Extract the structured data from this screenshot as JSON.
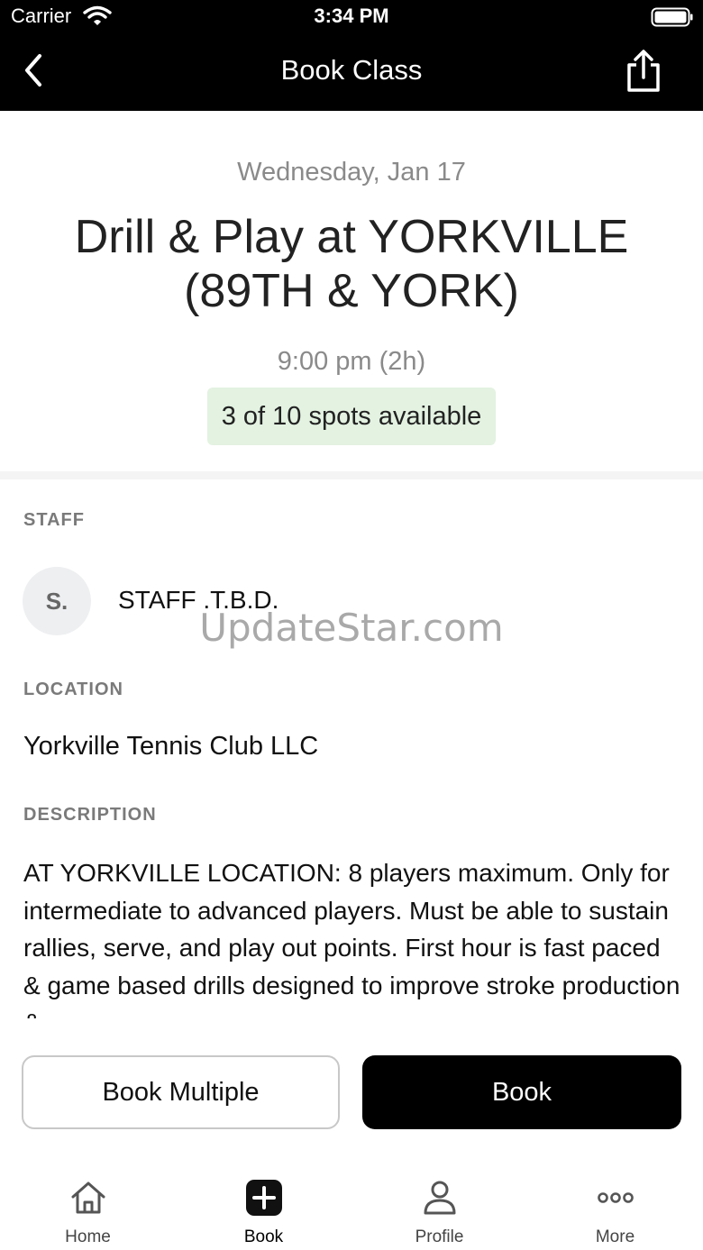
{
  "status_bar": {
    "carrier": "Carrier",
    "time": "3:34 PM"
  },
  "nav": {
    "title": "Book Class"
  },
  "class": {
    "date": "Wednesday, Jan 17",
    "title": "Drill & Play at YORKVILLE (89TH & YORK)",
    "time": "9:00 pm (2h)",
    "spots": "3 of 10 spots available"
  },
  "staff": {
    "label": "STAFF",
    "initial": "S.",
    "name": "STAFF .T.B.D."
  },
  "watermark": "UpdateStar.com",
  "location": {
    "label": "LOCATION",
    "name": "Yorkville Tennis Club LLC"
  },
  "description": {
    "label": "DESCRIPTION",
    "text": "AT YORKVILLE LOCATION: 8 players maximum. Only for intermediate to advanced players. Must be able to sustain rallies, serve, and play out points. First hour is fast paced & game based drills designed to improve stroke production &"
  },
  "actions": {
    "book_multiple": "Book Multiple",
    "book": "Book"
  },
  "tabs": [
    {
      "label": "Home",
      "icon": "home-icon"
    },
    {
      "label": "Book",
      "icon": "plus-icon",
      "active": true
    },
    {
      "label": "Profile",
      "icon": "person-icon"
    },
    {
      "label": "More",
      "icon": "more-icon"
    }
  ],
  "colors": {
    "nav_background": "#000000",
    "spots_badge_background": "#e3f2e1",
    "primary_button": "#000000"
  }
}
